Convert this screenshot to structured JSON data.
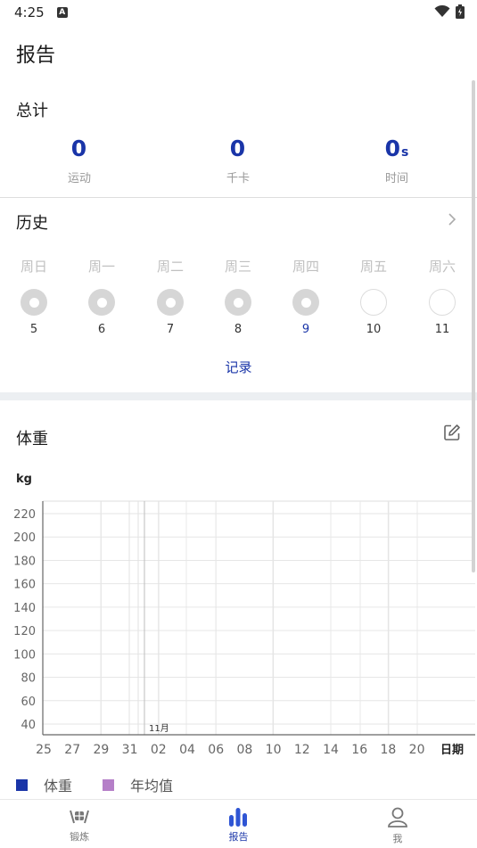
{
  "status_bar": {
    "time": "4:25",
    "notif_letter": "A"
  },
  "header": {
    "title": "报告"
  },
  "totals": {
    "title": "总计",
    "items": [
      {
        "value": "0",
        "unit": "",
        "label": "运动"
      },
      {
        "value": "0",
        "unit": "",
        "label": "千卡"
      },
      {
        "value": "0",
        "unit": "s",
        "label": "时间"
      }
    ]
  },
  "history": {
    "title": "历史",
    "days": [
      {
        "label": "周日",
        "date": "5",
        "done": true,
        "today": false
      },
      {
        "label": "周一",
        "date": "6",
        "done": true,
        "today": false
      },
      {
        "label": "周二",
        "date": "7",
        "done": true,
        "today": false
      },
      {
        "label": "周三",
        "date": "8",
        "done": true,
        "today": false
      },
      {
        "label": "周四",
        "date": "9",
        "done": true,
        "today": true
      },
      {
        "label": "周五",
        "date": "10",
        "done": false,
        "today": false
      },
      {
        "label": "周六",
        "date": "11",
        "done": false,
        "today": false
      }
    ],
    "record_label": "记录"
  },
  "weight": {
    "title": "体重",
    "unit_label": "kg"
  },
  "chart_data": {
    "type": "line",
    "ylim": [
      40,
      220
    ],
    "y_ticks": [
      40,
      60,
      80,
      100,
      120,
      140,
      160,
      180,
      200,
      220
    ],
    "x_ticks": [
      "25",
      "27",
      "29",
      "31",
      "02",
      "04",
      "06",
      "08",
      "10",
      "12",
      "14",
      "16",
      "18",
      "20"
    ],
    "x_label": "日期",
    "month_annotation": "11月",
    "grid": true,
    "series": [
      {
        "name": "体重",
        "color": "#1a35a8",
        "values": []
      },
      {
        "name": "年均值",
        "color": "#b57fc8",
        "values": []
      }
    ]
  },
  "nav": {
    "items": [
      {
        "label": "锻炼",
        "icon": "dumbbell-icon",
        "active": false
      },
      {
        "label": "报告",
        "icon": "bar-chart-icon",
        "active": true
      },
      {
        "label": "我",
        "icon": "person-icon",
        "active": false
      }
    ]
  },
  "colors": {
    "accent": "#1a35a8",
    "muted": "#9a9a9a"
  }
}
